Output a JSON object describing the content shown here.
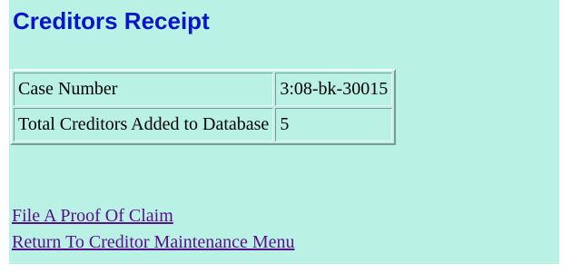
{
  "page": {
    "title": "Creditors Receipt"
  },
  "receipt_table": {
    "rows": [
      {
        "label": "Case Number",
        "value": "3:08-bk-30015"
      },
      {
        "label": "Total Creditors Added to Database",
        "value": "5"
      }
    ]
  },
  "links": {
    "file_claim": "File A Proof Of Claim",
    "return_menu": "Return To Creditor Maintenance Menu"
  },
  "colors": {
    "panel_background": "#b9f1e4",
    "title": "#0a14c8",
    "link": "#5a0f8c"
  }
}
